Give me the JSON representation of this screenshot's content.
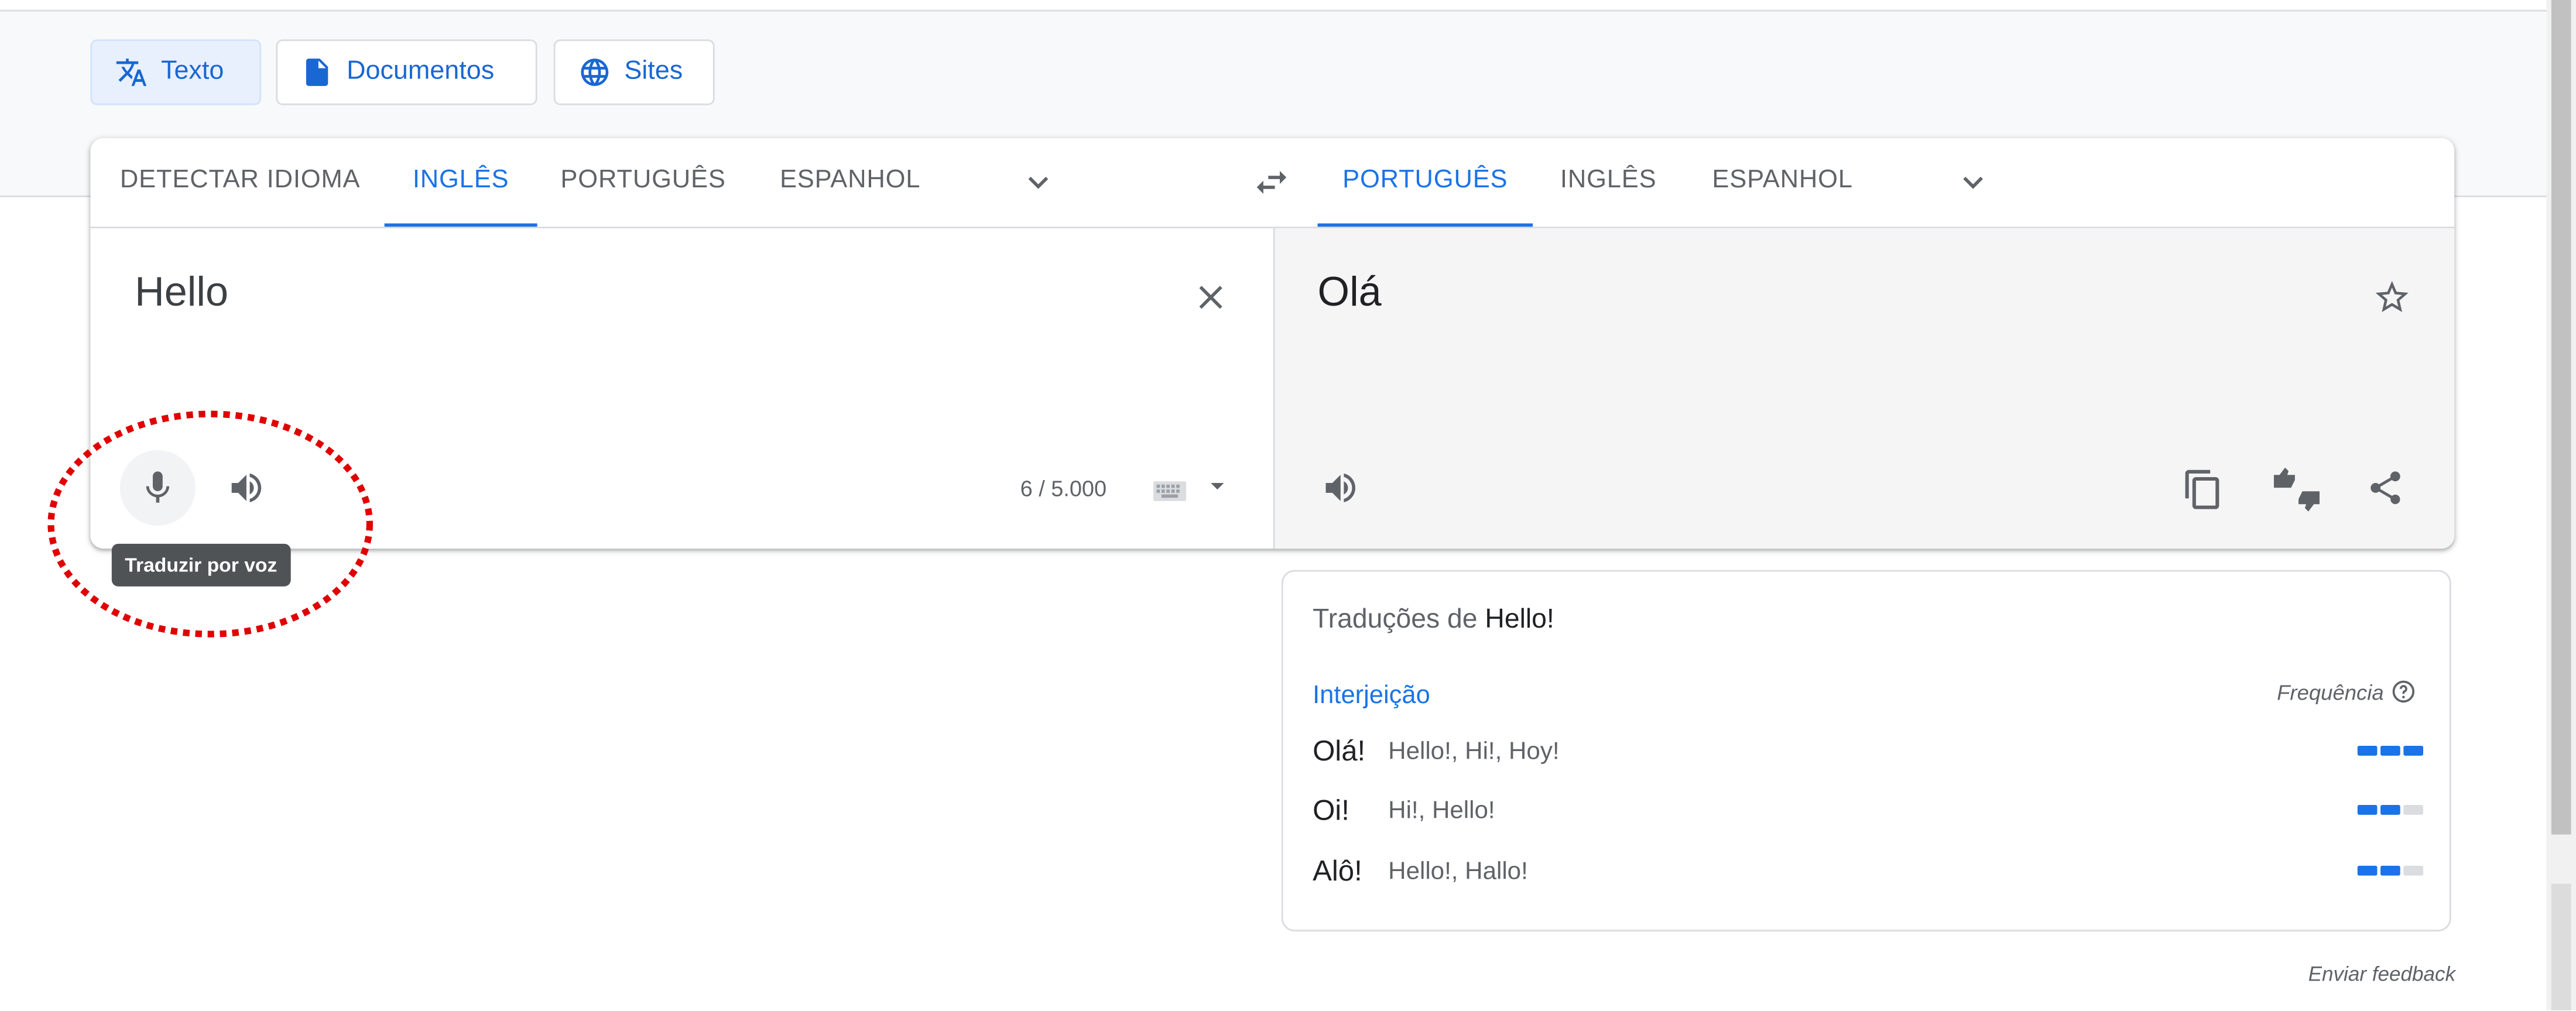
{
  "modes": [
    {
      "label": "Texto",
      "icon": "translate-icon",
      "active": true
    },
    {
      "label": "Documentos",
      "icon": "document-icon",
      "active": false
    },
    {
      "label": "Sites",
      "icon": "globe-icon",
      "active": false
    }
  ],
  "source": {
    "tabs": [
      "DETECTAR IDIOMA",
      "INGLÊS",
      "PORTUGUÊS",
      "ESPANHOL"
    ],
    "active_tab": "INGLÊS",
    "text": "Hello",
    "counter": "6 / 5.000",
    "tooltip": "Traduzir por voz"
  },
  "target": {
    "tabs": [
      "PORTUGUÊS",
      "INGLÊS",
      "ESPANHOL"
    ],
    "active_tab": "PORTUGUÊS",
    "text": "Olá"
  },
  "dictionary": {
    "title_prefix": "Traduções de",
    "title_word": "Hello!",
    "part_of_speech": "Interjeição",
    "frequency_label": "Frequência",
    "entries": [
      {
        "word": "Olá!",
        "synonyms": "Hello!, Hi!, Hoy!",
        "frequency": 3
      },
      {
        "word": "Oi!",
        "synonyms": "Hi!, Hello!",
        "frequency": 2
      },
      {
        "word": "Alô!",
        "synonyms": "Hello!, Hallo!",
        "frequency": 2
      }
    ]
  },
  "feedback": "Enviar feedback",
  "colors": {
    "accent": "#1a73e8",
    "annotation": "#e00000"
  }
}
